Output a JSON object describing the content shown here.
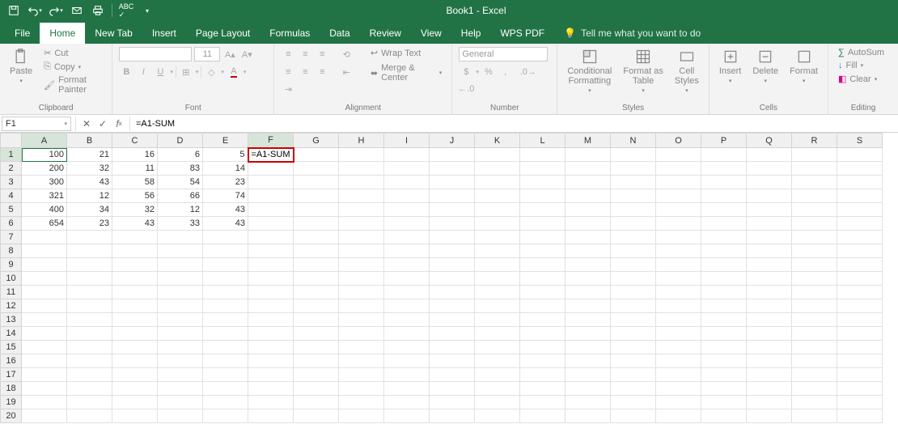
{
  "app": {
    "title": "Book1 - Excel"
  },
  "qat": [
    "save-icon",
    "undo-icon",
    "redo-icon",
    "email-icon",
    "quickprint-icon",
    "spellcheck-icon"
  ],
  "tabs": [
    {
      "label": "File",
      "active": false
    },
    {
      "label": "Home",
      "active": true
    },
    {
      "label": "New Tab",
      "active": false
    },
    {
      "label": "Insert",
      "active": false
    },
    {
      "label": "Page Layout",
      "active": false
    },
    {
      "label": "Formulas",
      "active": false
    },
    {
      "label": "Data",
      "active": false
    },
    {
      "label": "Review",
      "active": false
    },
    {
      "label": "View",
      "active": false
    },
    {
      "label": "Help",
      "active": false
    },
    {
      "label": "WPS PDF",
      "active": false
    }
  ],
  "tellme": "Tell me what you want to do",
  "ribbon": {
    "clipboard": {
      "label": "Clipboard",
      "paste": "Paste",
      "cut": "Cut",
      "copy": "Copy",
      "fmt": "Format Painter"
    },
    "font": {
      "label": "Font",
      "name": "",
      "size": "11"
    },
    "alignment": {
      "label": "Alignment",
      "wrap": "Wrap Text",
      "merge": "Merge & Center"
    },
    "number": {
      "label": "Number",
      "format": "General"
    },
    "styles": {
      "label": "Styles",
      "cond": "Conditional\nFormatting",
      "fmt": "Format as\nTable",
      "cell": "Cell\nStyles"
    },
    "cells": {
      "label": "Cells",
      "insert": "Insert",
      "delete": "Delete",
      "format": "Format"
    },
    "editing": {
      "label": "Editing",
      "autosum": "AutoSum",
      "fill": "Fill",
      "clear": "Clear"
    }
  },
  "formulaBar": {
    "nameBox": "F1",
    "formula": "=A1-SUM"
  },
  "grid": {
    "cols": [
      "A",
      "B",
      "C",
      "D",
      "E",
      "F",
      "G",
      "H",
      "I",
      "J",
      "K",
      "L",
      "M",
      "N",
      "O",
      "P",
      "Q",
      "R",
      "S"
    ],
    "rows": 20,
    "activeCell": {
      "row": 1,
      "col": "A"
    },
    "editingCell": {
      "row": 1,
      "col": "F",
      "value": "=A1-SUM"
    },
    "data": {
      "1": {
        "A": 100,
        "B": 21,
        "C": 16,
        "D": 6,
        "E": 5
      },
      "2": {
        "A": 200,
        "B": 32,
        "C": 11,
        "D": 83,
        "E": 14
      },
      "3": {
        "A": 300,
        "B": 43,
        "C": 58,
        "D": 54,
        "E": 23
      },
      "4": {
        "A": 321,
        "B": 12,
        "C": 56,
        "D": 66,
        "E": 74
      },
      "5": {
        "A": 400,
        "B": 34,
        "C": 32,
        "D": 12,
        "E": 43
      },
      "6": {
        "A": 654,
        "B": 23,
        "C": 43,
        "D": 33,
        "E": 43
      }
    }
  }
}
